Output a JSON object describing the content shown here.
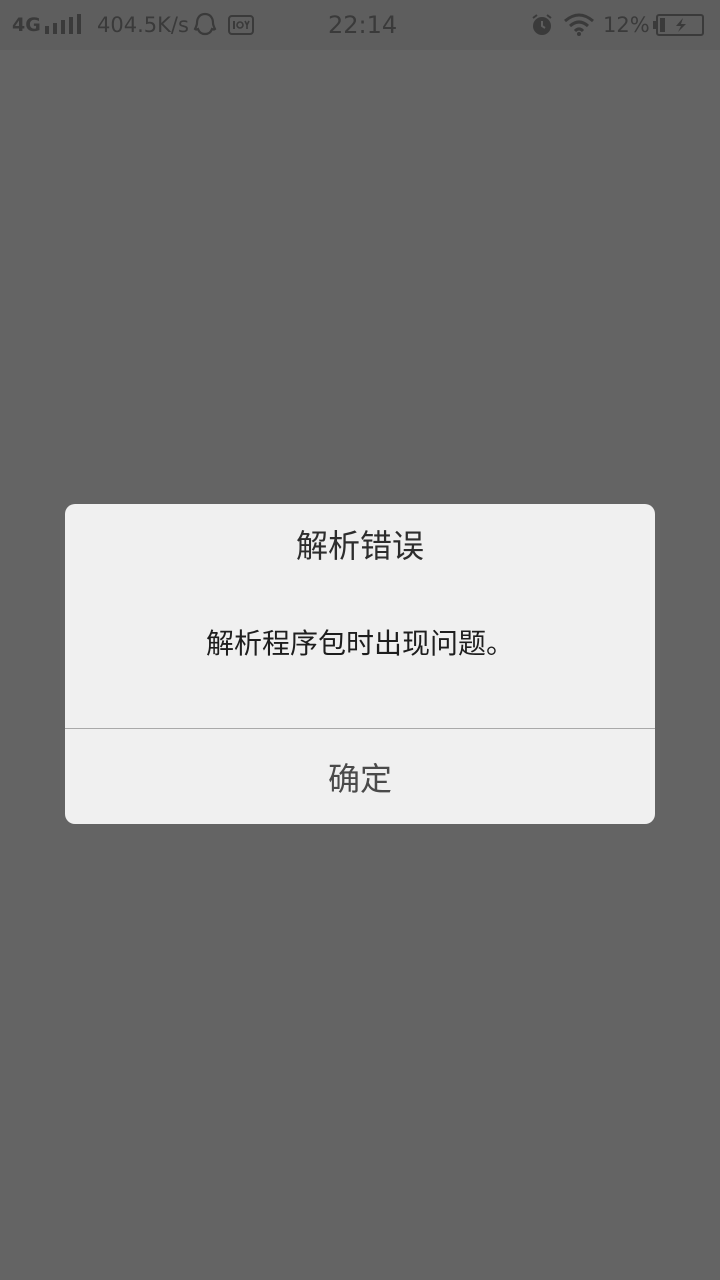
{
  "status_bar": {
    "network_type": "4G",
    "net_speed": "404.5K/s",
    "time": "22:14",
    "battery_percent": "12%",
    "icons": [
      "signal-icon",
      "qq-icon",
      "iqiyi-icon",
      "alarm-icon",
      "wifi-icon",
      "battery-charging-icon"
    ]
  },
  "dialog": {
    "title": "解析错误",
    "message": "解析程序包时出现问题。",
    "confirm_label": "确定"
  },
  "colors": {
    "overlay": "#646464",
    "dialog_background": "#f0f0f0",
    "divider": "#a9a9a9"
  }
}
